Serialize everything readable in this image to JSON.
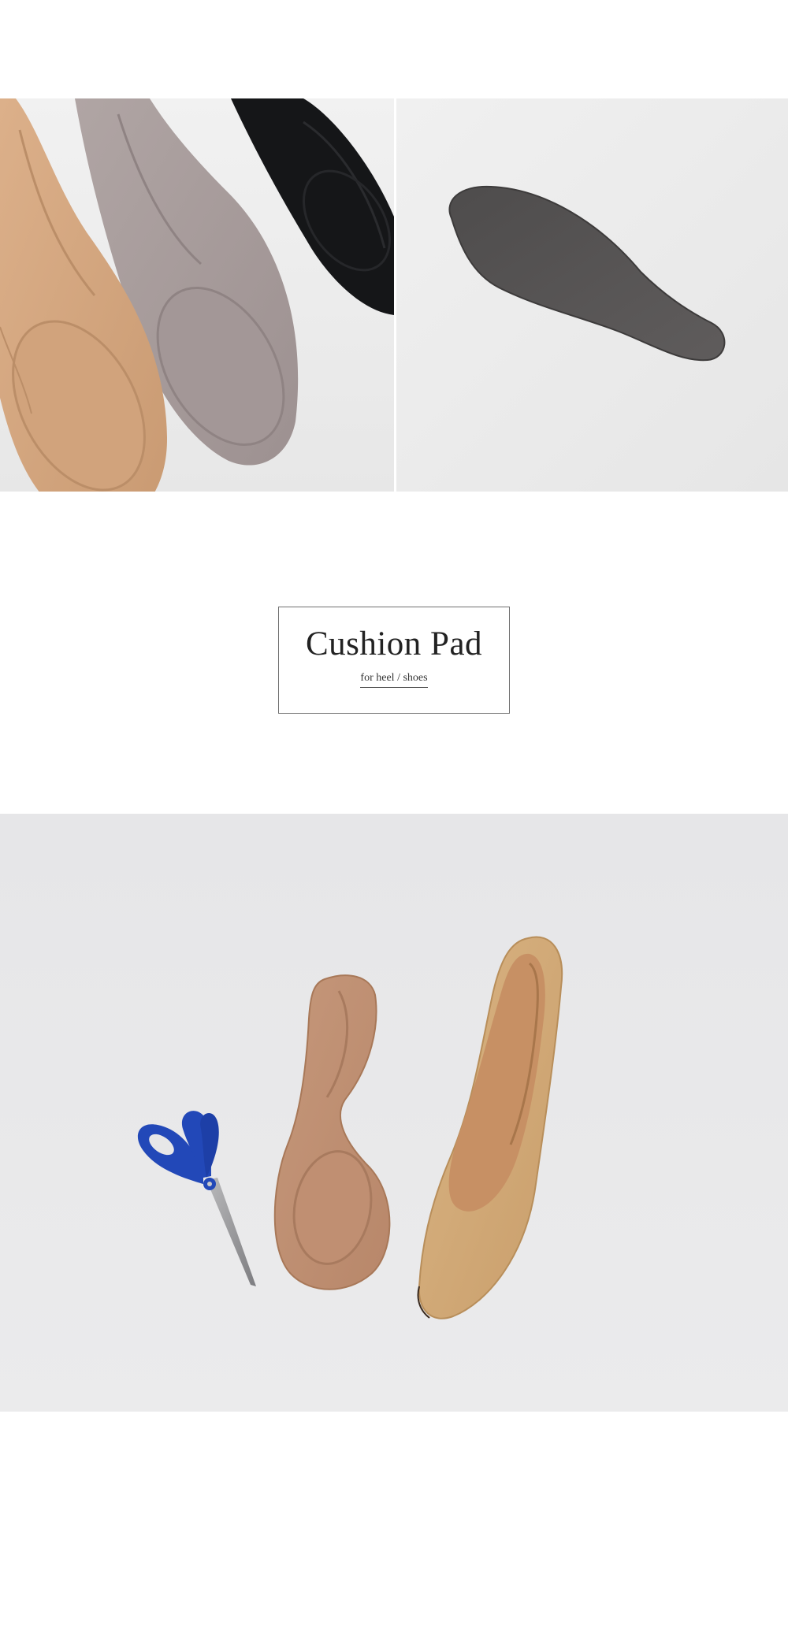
{
  "product": {
    "title": "Cushion Pad",
    "subtitle": "for heel / shoes"
  },
  "photos": {
    "top_left": "insoles-three-colors-photo",
    "top_right": "insole-underside-photo",
    "bottom": "insole-with-scissors-and-pump-photo"
  },
  "colors": {
    "background": "#ffffff",
    "photo_backdrop": "#e9e9ea",
    "beige_insole": "#d4a780",
    "gray_insole": "#a79b9a",
    "black_insole": "#141517",
    "underside_felt": "#555353",
    "scissor_handle": "#2248b8",
    "suede_pump": "#d0a875"
  }
}
